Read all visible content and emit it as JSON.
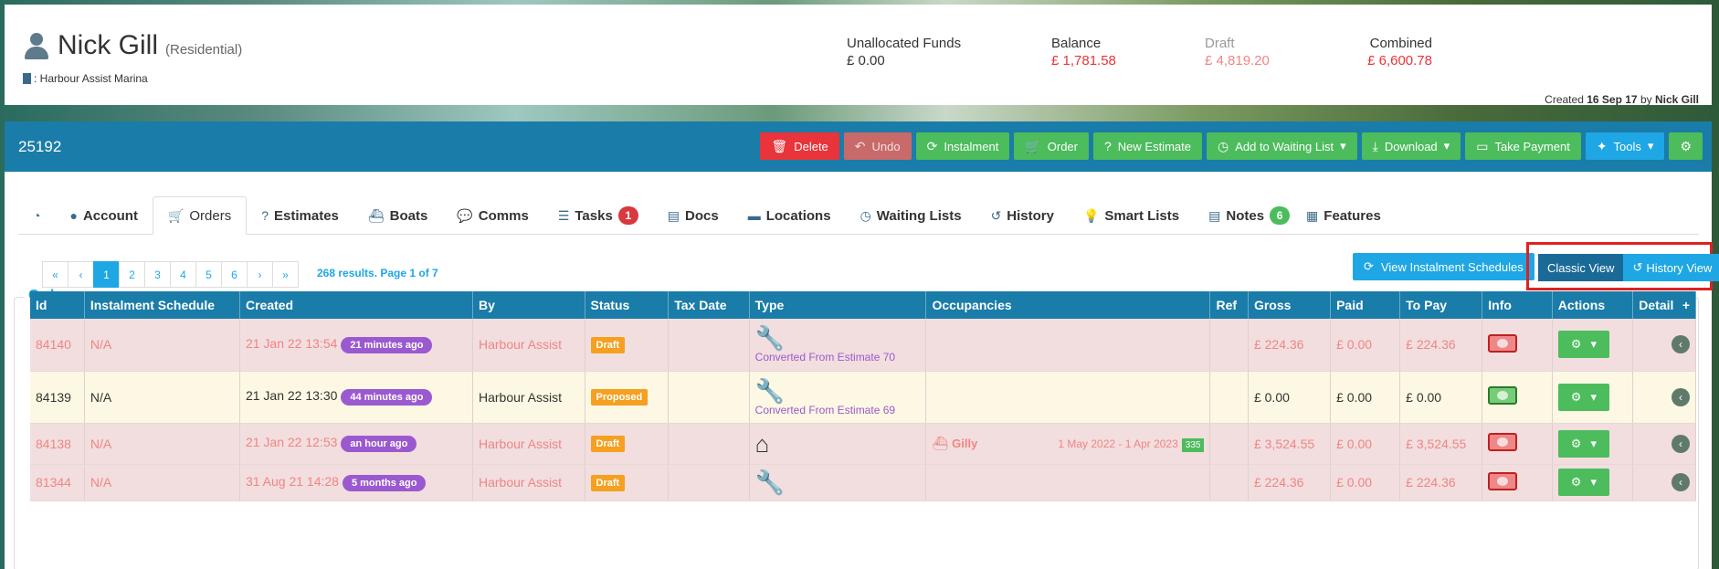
{
  "customer": {
    "name": "Nick Gill",
    "type": "(Residential)",
    "marina": ": Harbour Assist Marina"
  },
  "funds": [
    {
      "label": "Unallocated Funds",
      "value": "£ 0.00",
      "tone": "normal"
    },
    {
      "label": "Balance",
      "value": "£ 1,781.58",
      "tone": "red"
    },
    {
      "label": "Draft",
      "value": "£ 4,819.20",
      "tone": "draft"
    },
    {
      "label": "Combined",
      "value": "£ 6,600.78",
      "tone": "red"
    }
  ],
  "created": {
    "prefix": "Created",
    "date": "16 Sep 17",
    "by": "by",
    "user": "Nick Gill"
  },
  "toolbar": {
    "record_id": "25192",
    "buttons": [
      {
        "label": "Delete",
        "icon": "trash-icon",
        "color": "red"
      },
      {
        "label": "Undo",
        "icon": "undo-icon",
        "color": "dred"
      },
      {
        "label": "Instalment",
        "icon": "refresh-icon",
        "color": "green"
      },
      {
        "label": "Order",
        "icon": "cart-icon",
        "color": "green"
      },
      {
        "label": "New Estimate",
        "icon": "question-icon",
        "color": "green"
      },
      {
        "label": "Add to Waiting List",
        "icon": "clock-icon",
        "color": "green",
        "caret": true
      },
      {
        "label": "Download",
        "icon": "download-icon",
        "color": "green",
        "caret": true
      },
      {
        "label": "Take Payment",
        "icon": "money-icon",
        "color": "green"
      },
      {
        "label": "Tools",
        "icon": "wand-icon",
        "color": "blue",
        "caret": true
      },
      {
        "label": "",
        "icon": "gear-icon",
        "color": "green"
      }
    ]
  },
  "tabs": [
    {
      "label": "",
      "icon": "dashboard-icon"
    },
    {
      "label": "Account",
      "icon": "user-icon"
    },
    {
      "label": "Orders",
      "icon": "cart-icon",
      "active": true
    },
    {
      "label": "Estimates",
      "icon": "question-icon"
    },
    {
      "label": "Boats",
      "icon": "boat-icon"
    },
    {
      "label": "Comms",
      "icon": "comments-icon"
    },
    {
      "label": "Tasks",
      "icon": "tasks-icon",
      "badge": "1",
      "badge_color": "red"
    },
    {
      "label": "Docs",
      "icon": "file-icon"
    },
    {
      "label": "Locations",
      "icon": "bed-icon"
    },
    {
      "label": "Waiting Lists",
      "icon": "clock-icon"
    },
    {
      "label": "History",
      "icon": "history-icon"
    },
    {
      "label": "Smart Lists",
      "icon": "bulb-icon"
    },
    {
      "label": "Notes",
      "icon": "note-icon",
      "badge": "6",
      "badge_color": "green"
    },
    {
      "label": "Features",
      "icon": "grid-icon"
    }
  ],
  "view_schedules_label": "View Instalment Schedules",
  "view_toggle": {
    "classic": "Classic View",
    "history": "History View"
  },
  "orders_title": "Orders",
  "pagination": {
    "items": [
      "«",
      "‹",
      "1",
      "2",
      "3",
      "4",
      "5",
      "6",
      "›",
      "»"
    ],
    "active": "1",
    "info": "268 results. Page 1 of 7"
  },
  "table": {
    "columns": [
      "Id",
      "Instalment Schedule",
      "Created",
      "By",
      "Status",
      "Tax Date",
      "Type",
      "Occupancies",
      "Ref",
      "Gross",
      "Paid",
      "To Pay",
      "Info",
      "Actions",
      "Detail"
    ],
    "add_symbol": "+",
    "rows": [
      {
        "id": "84140",
        "schedule": "N/A",
        "created": "21 Jan 22 13:54",
        "ago": "21 minutes ago",
        "by": "Harbour Assist",
        "status": "Draft",
        "tax_date": "",
        "type_icon": "wrench-icon",
        "type_note": "Converted From Estimate 70",
        "boat": "",
        "dates": "",
        "nights": "",
        "ref": "",
        "gross": "£ 224.36",
        "paid": "£ 0.00",
        "to_pay": "£ 224.36",
        "info": "red",
        "row_color": "pink"
      },
      {
        "id": "84139",
        "schedule": "N/A",
        "created": "21 Jan 22 13:30",
        "ago": "44 minutes ago",
        "by": "Harbour Assist",
        "status": "Proposed",
        "tax_date": "",
        "type_icon": "wrench-icon",
        "type_note": "Converted From Estimate 69",
        "boat": "",
        "dates": "",
        "nights": "",
        "ref": "",
        "gross": "£ 0.00",
        "paid": "£ 0.00",
        "to_pay": "£ 0.00",
        "info": "green",
        "row_color": "yellow"
      },
      {
        "id": "84138",
        "schedule": "N/A",
        "created": "21 Jan 22 12:53",
        "ago": "an hour ago",
        "by": "Harbour Assist",
        "status": "Draft",
        "tax_date": "",
        "type_icon": "home-icon",
        "type_note": "",
        "boat": "Gilly",
        "dates": "1 May 2022 - 1 Apr 2023",
        "nights": "335",
        "ref": "",
        "gross": "£ 3,524.55",
        "paid": "£ 0.00",
        "to_pay": "£ 3,524.55",
        "info": "red",
        "row_color": "pink"
      },
      {
        "id": "81344",
        "schedule": "N/A",
        "created": "31 Aug 21 14:28",
        "ago": "5 months ago",
        "by": "Harbour Assist",
        "status": "Draft",
        "tax_date": "",
        "type_icon": "wrench-icon",
        "type_note": "",
        "boat": "",
        "dates": "",
        "nights": "",
        "ref": "",
        "gross": "£ 224.36",
        "paid": "£ 0.00",
        "to_pay": "£ 224.36",
        "info": "red",
        "row_color": "pink"
      }
    ]
  }
}
